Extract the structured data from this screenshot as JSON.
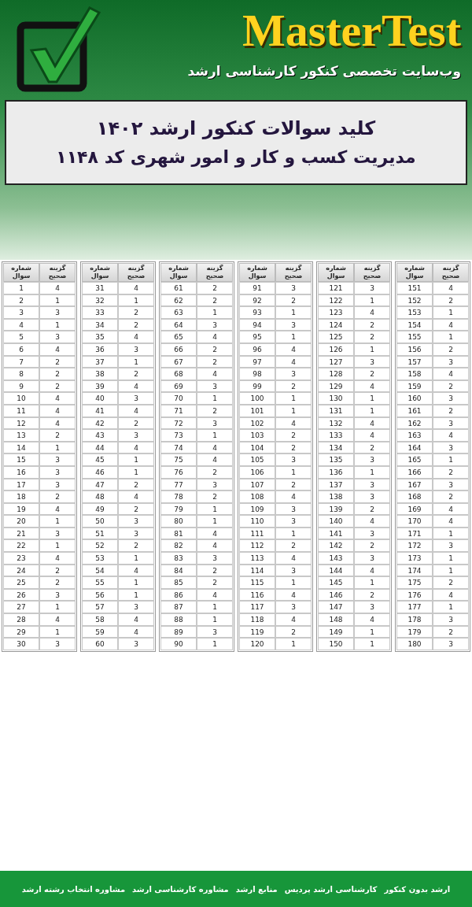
{
  "header": {
    "logo_text": "MasterTest",
    "tagline": "وب‌سایت تخصصی کنکور کارشناسی ارشد"
  },
  "title_box": {
    "title": "کلید سوالات کنکور ارشد ۱۴۰۲",
    "subtitle": "مدیریت کسب و کار و امور شهری کد ۱۱۴۸"
  },
  "answer_tables": {
    "tables": [
      {
        "columns": [
          "شماره سوال",
          "گزینه صحیح"
        ],
        "rows": [
          [
            "151",
            "4"
          ],
          [
            "152",
            "2"
          ],
          [
            "153",
            "1"
          ],
          [
            "154",
            "4"
          ],
          [
            "155",
            "1"
          ],
          [
            "156",
            "2"
          ],
          [
            "157",
            "3"
          ],
          [
            "158",
            "4"
          ],
          [
            "159",
            "2"
          ],
          [
            "160",
            "3"
          ],
          [
            "161",
            "2"
          ],
          [
            "162",
            "3"
          ],
          [
            "163",
            "4"
          ],
          [
            "164",
            "3"
          ],
          [
            "165",
            "1"
          ],
          [
            "166",
            "2"
          ],
          [
            "167",
            "3"
          ],
          [
            "168",
            "2"
          ],
          [
            "169",
            "4"
          ],
          [
            "170",
            "4"
          ],
          [
            "171",
            "1"
          ],
          [
            "172",
            "3"
          ],
          [
            "173",
            "1"
          ],
          [
            "174",
            "1"
          ],
          [
            "175",
            "2"
          ],
          [
            "176",
            "4"
          ],
          [
            "177",
            "1"
          ],
          [
            "178",
            "3"
          ],
          [
            "179",
            "2"
          ],
          [
            "180",
            "3"
          ]
        ]
      },
      {
        "columns": [
          "شماره سوال",
          "گزینه صحیح"
        ],
        "rows": [
          [
            "121",
            "3"
          ],
          [
            "122",
            "1"
          ],
          [
            "123",
            "4"
          ],
          [
            "124",
            "2"
          ],
          [
            "125",
            "2"
          ],
          [
            "126",
            "1"
          ],
          [
            "127",
            "3"
          ],
          [
            "128",
            "2"
          ],
          [
            "129",
            "4"
          ],
          [
            "130",
            "1"
          ],
          [
            "131",
            "1"
          ],
          [
            "132",
            "4"
          ],
          [
            "133",
            "4"
          ],
          [
            "134",
            "2"
          ],
          [
            "135",
            "3"
          ],
          [
            "136",
            "1"
          ],
          [
            "137",
            "3"
          ],
          [
            "138",
            "3"
          ],
          [
            "139",
            "2"
          ],
          [
            "140",
            "4"
          ],
          [
            "141",
            "3"
          ],
          [
            "142",
            "2"
          ],
          [
            "143",
            "3"
          ],
          [
            "144",
            "4"
          ],
          [
            "145",
            "1"
          ],
          [
            "146",
            "2"
          ],
          [
            "147",
            "3"
          ],
          [
            "148",
            "4"
          ],
          [
            "149",
            "1"
          ],
          [
            "150",
            "1"
          ]
        ]
      },
      {
        "columns": [
          "شماره سوال",
          "گزینه صحیح"
        ],
        "rows": [
          [
            "91",
            "3"
          ],
          [
            "92",
            "2"
          ],
          [
            "93",
            "1"
          ],
          [
            "94",
            "3"
          ],
          [
            "95",
            "1"
          ],
          [
            "96",
            "4"
          ],
          [
            "97",
            "4"
          ],
          [
            "98",
            "3"
          ],
          [
            "99",
            "2"
          ],
          [
            "100",
            "1"
          ],
          [
            "101",
            "1"
          ],
          [
            "102",
            "4"
          ],
          [
            "103",
            "2"
          ],
          [
            "104",
            "2"
          ],
          [
            "105",
            "3"
          ],
          [
            "106",
            "1"
          ],
          [
            "107",
            "2"
          ],
          [
            "108",
            "4"
          ],
          [
            "109",
            "3"
          ],
          [
            "110",
            "3"
          ],
          [
            "111",
            "1"
          ],
          [
            "112",
            "2"
          ],
          [
            "113",
            "4"
          ],
          [
            "114",
            "3"
          ],
          [
            "115",
            "1"
          ],
          [
            "116",
            "4"
          ],
          [
            "117",
            "3"
          ],
          [
            "118",
            "4"
          ],
          [
            "119",
            "2"
          ],
          [
            "120",
            "1"
          ]
        ]
      },
      {
        "columns": [
          "شماره سوال",
          "گزینه صحیح"
        ],
        "rows": [
          [
            "61",
            "2"
          ],
          [
            "62",
            "2"
          ],
          [
            "63",
            "1"
          ],
          [
            "64",
            "3"
          ],
          [
            "65",
            "4"
          ],
          [
            "66",
            "2"
          ],
          [
            "67",
            "2"
          ],
          [
            "68",
            "4"
          ],
          [
            "69",
            "3"
          ],
          [
            "70",
            "1"
          ],
          [
            "71",
            "2"
          ],
          [
            "72",
            "3"
          ],
          [
            "73",
            "1"
          ],
          [
            "74",
            "4"
          ],
          [
            "75",
            "4"
          ],
          [
            "76",
            "2"
          ],
          [
            "77",
            "3"
          ],
          [
            "78",
            "2"
          ],
          [
            "79",
            "1"
          ],
          [
            "80",
            "1"
          ],
          [
            "81",
            "4"
          ],
          [
            "82",
            "4"
          ],
          [
            "83",
            "3"
          ],
          [
            "84",
            "2"
          ],
          [
            "85",
            "2"
          ],
          [
            "86",
            "4"
          ],
          [
            "87",
            "1"
          ],
          [
            "88",
            "1"
          ],
          [
            "89",
            "3"
          ],
          [
            "90",
            "1"
          ]
        ]
      },
      {
        "columns": [
          "شماره سوال",
          "گزینه صحیح"
        ],
        "rows": [
          [
            "31",
            "4"
          ],
          [
            "32",
            "1"
          ],
          [
            "33",
            "2"
          ],
          [
            "34",
            "2"
          ],
          [
            "35",
            "4"
          ],
          [
            "36",
            "3"
          ],
          [
            "37",
            "1"
          ],
          [
            "38",
            "2"
          ],
          [
            "39",
            "4"
          ],
          [
            "40",
            "3"
          ],
          [
            "41",
            "4"
          ],
          [
            "42",
            "2"
          ],
          [
            "43",
            "3"
          ],
          [
            "44",
            "4"
          ],
          [
            "45",
            "1"
          ],
          [
            "46",
            "1"
          ],
          [
            "47",
            "2"
          ],
          [
            "48",
            "4"
          ],
          [
            "49",
            "2"
          ],
          [
            "50",
            "3"
          ],
          [
            "51",
            "3"
          ],
          [
            "52",
            "2"
          ],
          [
            "53",
            "1"
          ],
          [
            "54",
            "4"
          ],
          [
            "55",
            "1"
          ],
          [
            "56",
            "1"
          ],
          [
            "57",
            "3"
          ],
          [
            "58",
            "4"
          ],
          [
            "59",
            "4"
          ],
          [
            "60",
            "3"
          ]
        ]
      },
      {
        "columns": [
          "شماره سوال",
          "گزینه صحیح"
        ],
        "rows": [
          [
            "1",
            "4"
          ],
          [
            "2",
            "1"
          ],
          [
            "3",
            "3"
          ],
          [
            "4",
            "1"
          ],
          [
            "5",
            "3"
          ],
          [
            "6",
            "4"
          ],
          [
            "7",
            "2"
          ],
          [
            "8",
            "2"
          ],
          [
            "9",
            "2"
          ],
          [
            "10",
            "4"
          ],
          [
            "11",
            "4"
          ],
          [
            "12",
            "4"
          ],
          [
            "13",
            "2"
          ],
          [
            "14",
            "1"
          ],
          [
            "15",
            "3"
          ],
          [
            "16",
            "3"
          ],
          [
            "17",
            "3"
          ],
          [
            "18",
            "2"
          ],
          [
            "19",
            "4"
          ],
          [
            "20",
            "1"
          ],
          [
            "21",
            "3"
          ],
          [
            "22",
            "1"
          ],
          [
            "23",
            "4"
          ],
          [
            "24",
            "2"
          ],
          [
            "25",
            "2"
          ],
          [
            "26",
            "3"
          ],
          [
            "27",
            "1"
          ],
          [
            "28",
            "4"
          ],
          [
            "29",
            "1"
          ],
          [
            "30",
            "3"
          ]
        ]
      }
    ]
  },
  "footer_links": [
    "ارشد بدون کنکور",
    "کارشناسی ارشد پردیس",
    "منابع ارشد",
    "مشاوره کارشناسی ارشد",
    "مشاوره انتخاب رشته ارشد"
  ]
}
